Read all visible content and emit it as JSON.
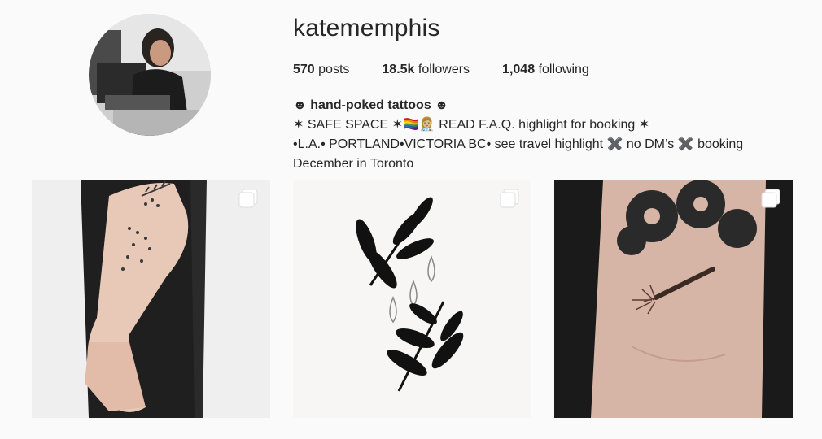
{
  "profile": {
    "username": "katememphis",
    "avatar_icon": "profile-photo"
  },
  "stats": {
    "posts_count": "570",
    "posts_label": "posts",
    "followers_count": "18.5k",
    "followers_label": "followers",
    "following_count": "1,048",
    "following_label": "following"
  },
  "bio": {
    "name": "☻ hand-poked tattoos ☻",
    "line1": "✶ SAFE SPACE ✶🏳️‍🌈👩🏼‍⚕️ READ F.A.Q. highlight for booking ✶",
    "line2": "•L.A.• PORTLAND•VICTORIA BC• see travel highlight ✖️ no DM’s ✖️ booking",
    "line3": "December in Toronto"
  },
  "posts": [
    {
      "type": "multiple",
      "icon": "carousel-icon"
    },
    {
      "type": "multiple",
      "icon": "carousel-icon"
    },
    {
      "type": "multiple",
      "icon": "carousel-icon"
    }
  ]
}
